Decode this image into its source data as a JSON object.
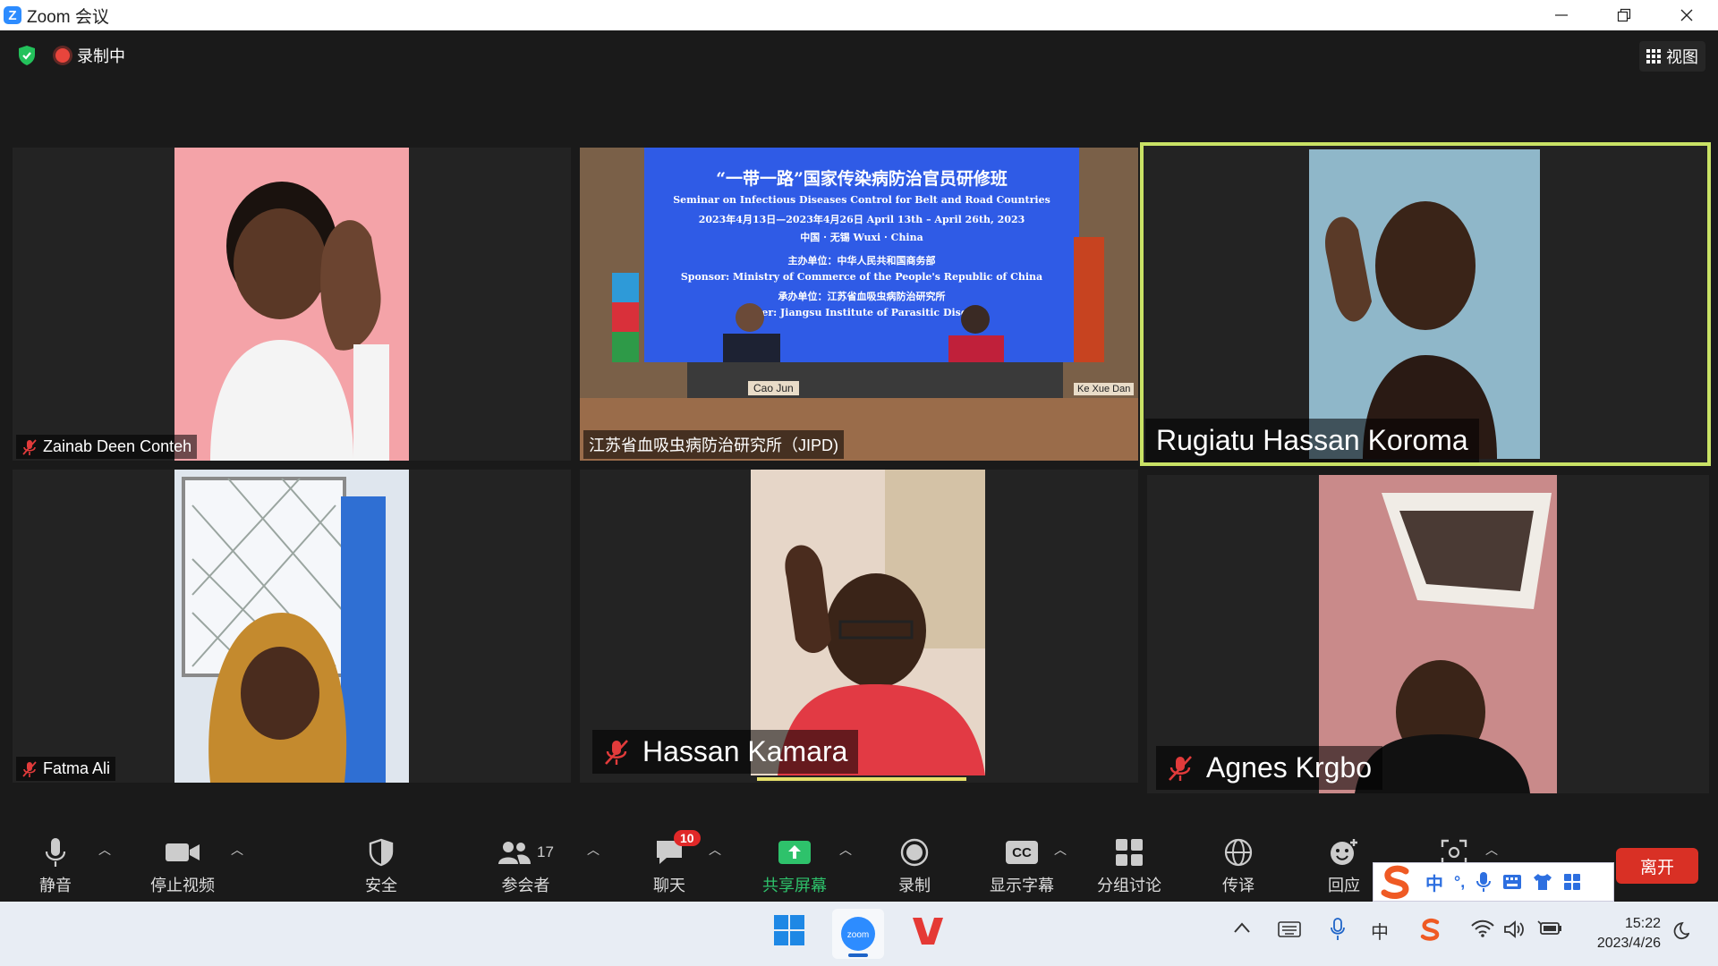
{
  "window": {
    "title": "Zoom 会议",
    "logo": "Z"
  },
  "meeting": {
    "recording_label": "录制中",
    "view_label": "视图"
  },
  "tiles": [
    {
      "name": "Zainab Deen Conteh",
      "muted": true,
      "bg": "#f4a3a8"
    },
    {
      "name": "江苏省血吸虫病防治研究所（JIPD)",
      "muted": false,
      "bg": "#3b5bd8"
    },
    {
      "name": "Rugiatu Hassan Koroma",
      "muted": false,
      "bg": "#8fb7c9",
      "speaking": true
    },
    {
      "name": "Fatma Ali",
      "muted": true,
      "bg": "#dfe6ee"
    },
    {
      "name": "Hassan Kamara",
      "muted": true,
      "bg": "#e6d6c8"
    },
    {
      "name": "Agnes Krgbo",
      "muted": true,
      "bg": "#c98a8a"
    }
  ],
  "banner": {
    "title": "“一带一路”国家传染病防治官员研修班",
    "subtitle": "Seminar on Infectious Diseases Control for Belt and Road Countries",
    "dates": "2023年4月13日—2023年4月26日  April 13th – April 26th, 2023",
    "place": "中国 · 无锡  Wuxi · China",
    "sponsor_cn": "主办单位：中华人民共和国商务部",
    "sponsor_en": "Sponsor: Ministry of Commerce of the People's Republic of China",
    "organizer_cn": "承办单位：江苏省血吸虫病防治研究所",
    "organizer_en": "zer: Jiangsu Institute of Parasitic Dise",
    "nameplate_left": "Cao Jun",
    "nameplate_right": "Ke Xue Dan"
  },
  "toolbar": {
    "mute": "静音",
    "stop_video": "停止视频",
    "security": "安全",
    "participants": "参会者",
    "participants_count": "17",
    "chat": "聊天",
    "chat_badge": "10",
    "share": "共享屏幕",
    "record": "录制",
    "captions": "显示字幕",
    "captions_icon": "CC",
    "breakout": "分组讨论",
    "interpret": "传译",
    "reactions": "回应",
    "leave": "离开"
  },
  "ime": {
    "mode": "中",
    "punct": "°,"
  },
  "taskbar": {
    "time": "15:22",
    "date": "2023/4/26",
    "input_lang": "中"
  },
  "colors": {
    "accent": "#2d8cff",
    "share_green": "#2ec26b",
    "speaking_outline": "#c9e265",
    "leave_red": "#d93025"
  }
}
